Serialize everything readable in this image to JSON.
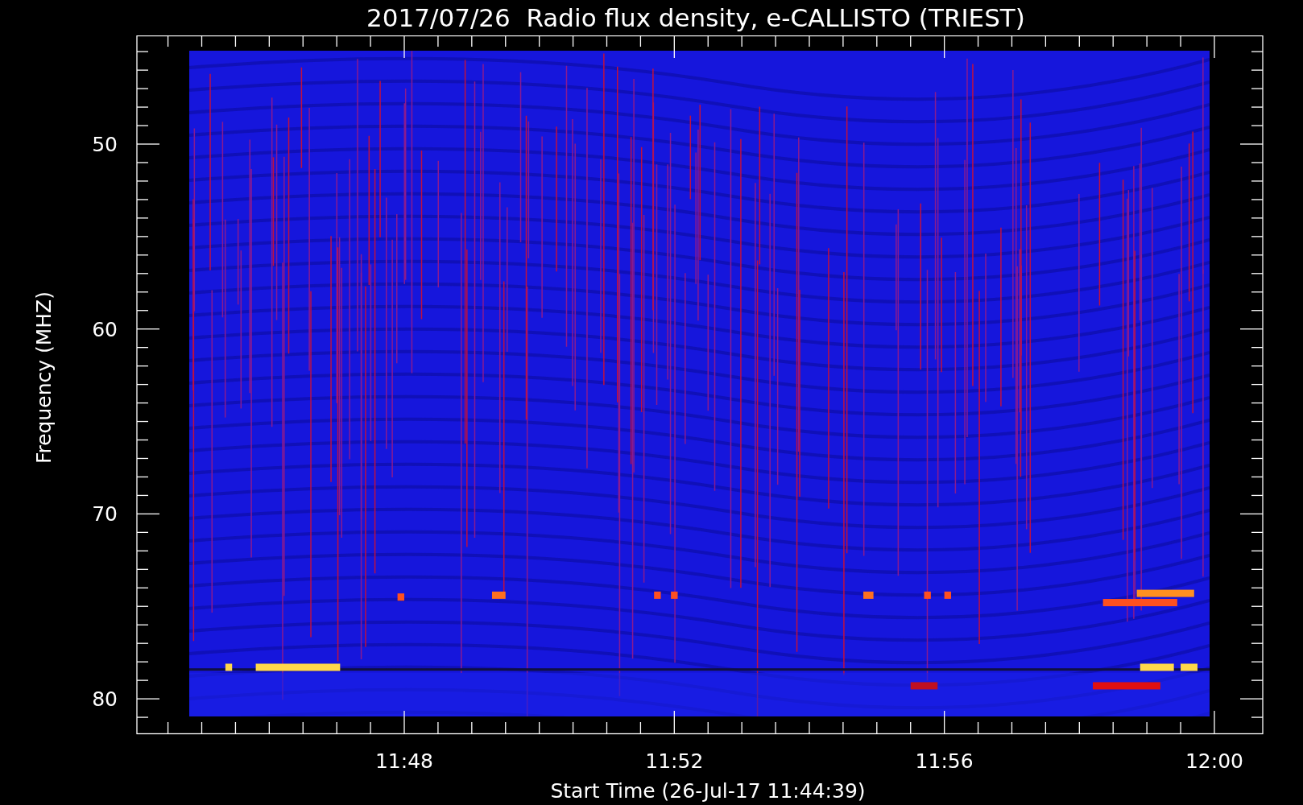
{
  "plot": {
    "title": "2017/07/26  Radio flux density, e-CALLISTO (TRIEST)",
    "y_axis": {
      "label": "Frequency (MHZ)",
      "ticks": [
        "50",
        "60",
        "70",
        "80"
      ]
    },
    "x_axis": {
      "label": "Start Time (26-Jul-17 11:44:39)",
      "ticks": [
        "11:48",
        "11:52",
        "11:56",
        "12:00"
      ]
    }
  }
}
